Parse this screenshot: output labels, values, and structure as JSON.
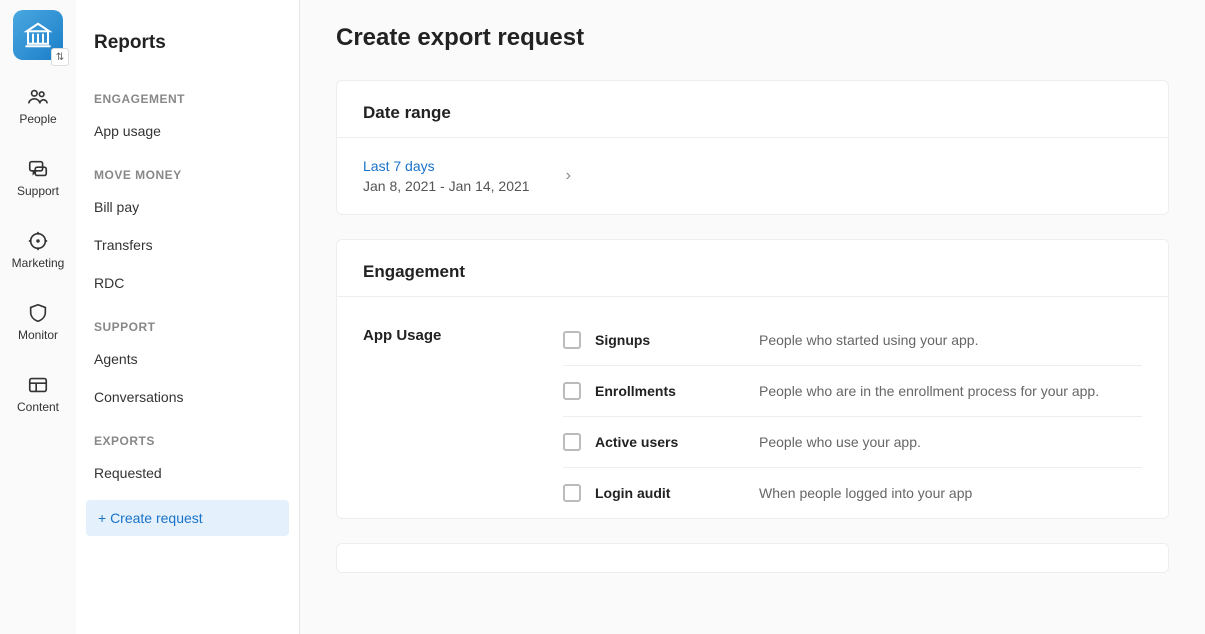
{
  "rail": {
    "items": [
      {
        "label": "People"
      },
      {
        "label": "Support"
      },
      {
        "label": "Marketing"
      },
      {
        "label": "Monitor"
      },
      {
        "label": "Content"
      }
    ]
  },
  "sidebar": {
    "title": "Reports",
    "sections": [
      {
        "head": "ENGAGEMENT",
        "items": [
          {
            "label": "App usage"
          }
        ]
      },
      {
        "head": "MOVE MONEY",
        "items": [
          {
            "label": "Bill pay"
          },
          {
            "label": "Transfers"
          },
          {
            "label": "RDC"
          }
        ]
      },
      {
        "head": "SUPPORT",
        "items": [
          {
            "label": "Agents"
          },
          {
            "label": "Conversations"
          }
        ]
      },
      {
        "head": "EXPORTS",
        "items": [
          {
            "label": "Requested"
          }
        ]
      }
    ],
    "create_label": "+ Create request"
  },
  "page": {
    "title": "Create export request",
    "date_card": {
      "header": "Date range",
      "preset": "Last 7 days",
      "range": "Jan 8, 2021 - Jan 14, 2021"
    },
    "engagement_card": {
      "header": "Engagement",
      "sublabel": "App Usage",
      "rows": [
        {
          "name": "Signups",
          "desc": "People who started using your app."
        },
        {
          "name": "Enrollments",
          "desc": "People who are in the enrollment process for your app."
        },
        {
          "name": "Active users",
          "desc": "People who use your app."
        },
        {
          "name": "Login audit",
          "desc": "When people logged into your app"
        }
      ]
    }
  }
}
